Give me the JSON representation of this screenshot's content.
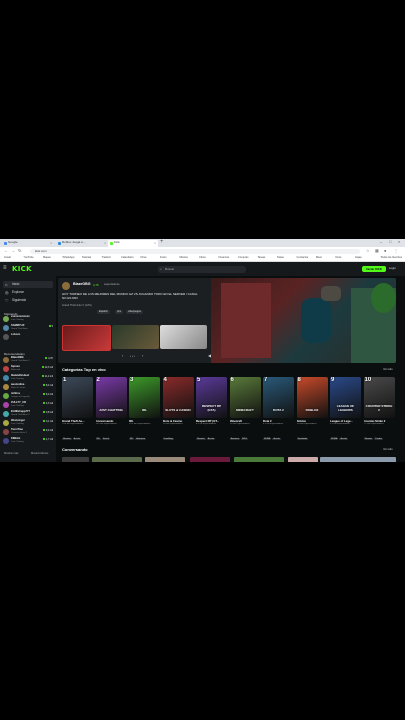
{
  "browser": {
    "tabs": [
      {
        "label": "Google",
        "color": "#4285f4"
      },
      {
        "label": "Roblox Juega a ...",
        "color": "#1e88e5"
      },
      {
        "label": "Kick",
        "color": "#53fc18"
      }
    ],
    "url": "kick.com",
    "new_tab": "+",
    "bookmarks": [
      "Gmail",
      "YouTube",
      "Mapas",
      "WhatsApp",
      "Noticias",
      "Traducir",
      "Calendario",
      "Drive",
      "Fotos",
      "Música",
      "Clima",
      "Finanzas",
      "Compras",
      "Tareas",
      "Notas",
      "Contactos",
      "Meet",
      "Docs",
      "Hojas",
      "Todos los favoritos"
    ]
  },
  "header": {
    "logo": "KICK",
    "search_placeholder": "Buscar",
    "go_live": "Iniciar KICK",
    "login": "Login"
  },
  "sidebar": {
    "nav": [
      {
        "label": "Inicio",
        "icon": "home-icon"
      },
      {
        "label": "Explorar",
        "icon": "compass-icon"
      },
      {
        "label": "Siguiendo",
        "icon": "heart-icon"
      }
    ],
    "following_title": "Siguiendo",
    "following": [
      {
        "name": "xxxxxxxxxxxxx",
        "cat": "Just Chatting",
        "viewers": "",
        "color": "#7a5"
      },
      {
        "name": "SAMMYLIF",
        "cat": "Grand Theft Auto",
        "viewers": "5",
        "color": "#58a"
      },
      {
        "name": "Lobozo",
        "cat": "",
        "viewers": "",
        "color": "#555"
      }
    ],
    "recommended_title": "Recomendados",
    "recommended": [
      {
        "name": "BlazeOBG",
        "cat": "Grand Theft Auto V",
        "viewers": "4,7K",
        "color": "#8a6d3b"
      },
      {
        "name": "Spreen",
        "cat": "Minecraft",
        "viewers": "12,3 mil",
        "color": "#b44"
      },
      {
        "name": "Ibaiandhisbest",
        "cat": "Just Chatting",
        "viewers": "11,4 mil",
        "color": "#48a"
      },
      {
        "name": "westcolina",
        "cat": "Slots & Casino",
        "viewers": "8,4 mil",
        "color": "#a84"
      },
      {
        "name": "mrlkiss",
        "cat": "League of Legends",
        "viewers": "6,2 mil",
        "color": "#6a4"
      },
      {
        "name": "ZULLTY_CR",
        "cat": "Just Chatting",
        "viewers": "4,3 mil",
        "color": "#a4a"
      },
      {
        "name": "ELMilchapp777",
        "cat": "Grand Theft Auto V",
        "viewers": "3,8 mil",
        "color": "#4aa"
      },
      {
        "name": "Westsinger",
        "cat": "Just Chatting",
        "viewers": "3,1 mil",
        "color": "#aa4"
      },
      {
        "name": "TwonTrae",
        "cat": "Counter-Strike 2",
        "viewers": "2,4 mil",
        "color": "#844"
      },
      {
        "name": "K8Bizix",
        "cat": "Just Chatting",
        "viewers": "1,7 mil",
        "color": "#448"
      }
    ],
    "footer_left": "Mostrar más",
    "footer_right": "Mostrar Menos"
  },
  "featured": {
    "streamer": "BlazeOBG",
    "live_count": "4,7K",
    "views_label": "espectadores",
    "title": "HOY TORNEO DE LOS MEJORES DEL MUNDO GZ VS JUGANDO TODO EN EL SERVER / CANAL NO ES MIO",
    "category": "Grand Theft Auto V (GTA)",
    "tags": [
      "Español",
      "rpm",
      "videojuegos"
    ]
  },
  "top_categories": {
    "title": "Categorías Top en vivo",
    "see_all": "Ver todo",
    "items": [
      {
        "rank": "1",
        "name": "Grand Theft Au...",
        "viewers": "79,8 mil espectadores",
        "tags": [
          "Shooter",
          "Acción"
        ],
        "color": "#3d4a5a",
        "art": ""
      },
      {
        "rank": "2",
        "name": "Conversando",
        "viewers": "70,4 mil espectadores",
        "tags": [
          "IRL",
          "Social"
        ],
        "color": "#7a3aa8",
        "art": "JUST CHATTING"
      },
      {
        "rank": "3",
        "name": "IRL",
        "viewers": "10,2 mil espectadores",
        "tags": [
          "IRL",
          "Aventura"
        ],
        "color": "#3d9a2a",
        "art": "IRL"
      },
      {
        "rank": "4",
        "name": "Slots & Casino",
        "viewers": "9,6 mil espectadores",
        "tags": [
          "Gambling"
        ],
        "color": "#8a2a2a",
        "art": "SLOTS & CASINO"
      },
      {
        "rank": "5",
        "name": "Respect RP (GT...",
        "viewers": "6,1 mil espectadores",
        "tags": [
          "Shooter",
          "Acción"
        ],
        "color": "#5a3a9a",
        "art": "RESPECT RP (GTA)"
      },
      {
        "rank": "6",
        "name": "Minecraft",
        "viewers": "5,6 mil espectadores",
        "tags": [
          "Aventura",
          "RPG"
        ],
        "color": "#5a7a3a",
        "art": "MINECRAFT"
      },
      {
        "rank": "7",
        "name": "Dota 2",
        "viewers": "4,2 mil espectadores",
        "tags": [
          "MOBA",
          "Acción"
        ],
        "color": "#2a5a7a",
        "art": "DOTA 2"
      },
      {
        "rank": "8",
        "name": "Roblox",
        "viewers": "3,6 mil espectadores",
        "tags": [
          "Simulador"
        ],
        "color": "#c84a2a",
        "art": "ROBLOX"
      },
      {
        "rank": "9",
        "name": "League of Lege...",
        "viewers": "3,1 mil espectadores",
        "tags": [
          "MOBA",
          "Acción"
        ],
        "color": "#2a4a8a",
        "art": "LEAGUE OF LEGENDS"
      },
      {
        "rank": "10",
        "name": "Counter-Strike 2",
        "viewers": "2,7 mil espectadores",
        "tags": [
          "Shooter",
          "Tirador"
        ],
        "color": "#4a4a4a",
        "art": "COUNTER STRIKE 2"
      }
    ]
  },
  "conversando": {
    "title": "Conversando",
    "see_all": "Ver todo"
  }
}
